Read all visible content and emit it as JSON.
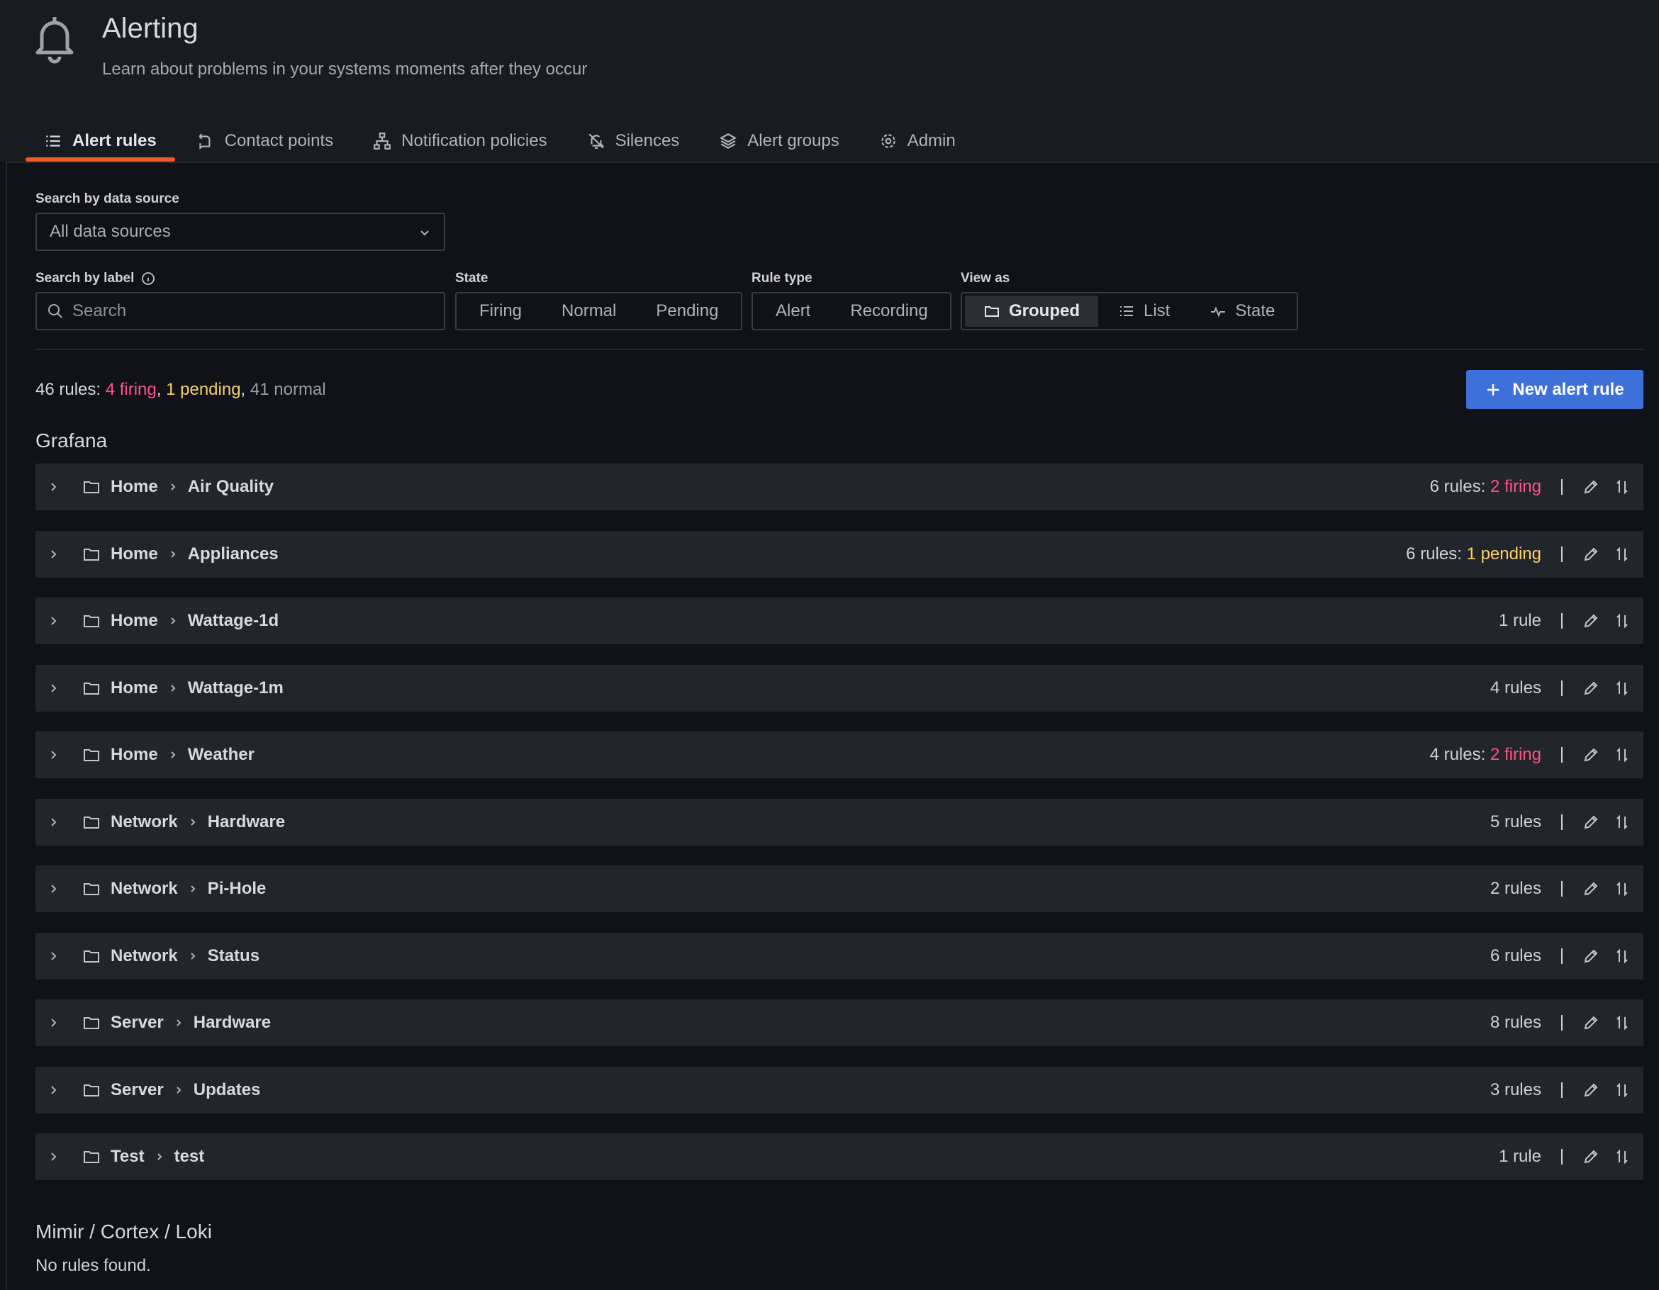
{
  "header": {
    "title": "Alerting",
    "subtitle": "Learn about problems in your systems moments after they occur",
    "icon": "bell-icon"
  },
  "tabs": [
    {
      "label": "Alert rules",
      "icon": "list-icon",
      "active": true
    },
    {
      "label": "Contact points",
      "icon": "comment-alt-share-icon",
      "active": false
    },
    {
      "label": "Notification policies",
      "icon": "sitemap-icon",
      "active": false
    },
    {
      "label": "Silences",
      "icon": "bell-slash-icon",
      "active": false
    },
    {
      "label": "Alert groups",
      "icon": "layer-group-icon",
      "active": false
    },
    {
      "label": "Admin",
      "icon": "cog-icon",
      "active": false
    }
  ],
  "filters": {
    "datasource_label": "Search by data source",
    "datasource_value": "All data sources",
    "label_label": "Search by label",
    "search_placeholder": "Search",
    "state_label": "State",
    "state_options": [
      "Firing",
      "Normal",
      "Pending"
    ],
    "ruletype_label": "Rule type",
    "ruletype_options": [
      "Alert",
      "Recording"
    ],
    "viewas_label": "View as",
    "viewas_options": [
      "Grouped",
      "List",
      "State"
    ],
    "viewas_selected": "Grouped"
  },
  "summary": {
    "total": "46 rules: ",
    "firing": "4 firing",
    "sep1": ", ",
    "pending": "1 pending",
    "sep2": ", ",
    "normal": "41 normal"
  },
  "new_rule_label": "New alert rule",
  "colors": {
    "accent": "#3d71d9",
    "tab_active": "#f05a28",
    "firing": "#ff5286",
    "pending": "#f8d06b"
  },
  "sections": {
    "grafana": "Grafana",
    "mimir": "Mimir / Cortex / Loki",
    "mimir_empty": "No rules found."
  },
  "groups": [
    {
      "namespace": "Home",
      "group": "Air Quality",
      "count": "6 rules",
      "status": "2 firing",
      "status_kind": "firing"
    },
    {
      "namespace": "Home",
      "group": "Appliances",
      "count": "6 rules",
      "status": "1 pending",
      "status_kind": "pending"
    },
    {
      "namespace": "Home",
      "group": "Wattage-1d",
      "count": "1 rule",
      "status": "",
      "status_kind": ""
    },
    {
      "namespace": "Home",
      "group": "Wattage-1m",
      "count": "4 rules",
      "status": "",
      "status_kind": ""
    },
    {
      "namespace": "Home",
      "group": "Weather",
      "count": "4 rules",
      "status": "2 firing",
      "status_kind": "firing"
    },
    {
      "namespace": "Network",
      "group": "Hardware",
      "count": "5 rules",
      "status": "",
      "status_kind": ""
    },
    {
      "namespace": "Network",
      "group": "Pi-Hole",
      "count": "2 rules",
      "status": "",
      "status_kind": ""
    },
    {
      "namespace": "Network",
      "group": "Status",
      "count": "6 rules",
      "status": "",
      "status_kind": ""
    },
    {
      "namespace": "Server",
      "group": "Hardware",
      "count": "8 rules",
      "status": "",
      "status_kind": ""
    },
    {
      "namespace": "Server",
      "group": "Updates",
      "count": "3 rules",
      "status": "",
      "status_kind": ""
    },
    {
      "namespace": "Test",
      "group": "test",
      "count": "1 rule",
      "status": "",
      "status_kind": ""
    }
  ]
}
